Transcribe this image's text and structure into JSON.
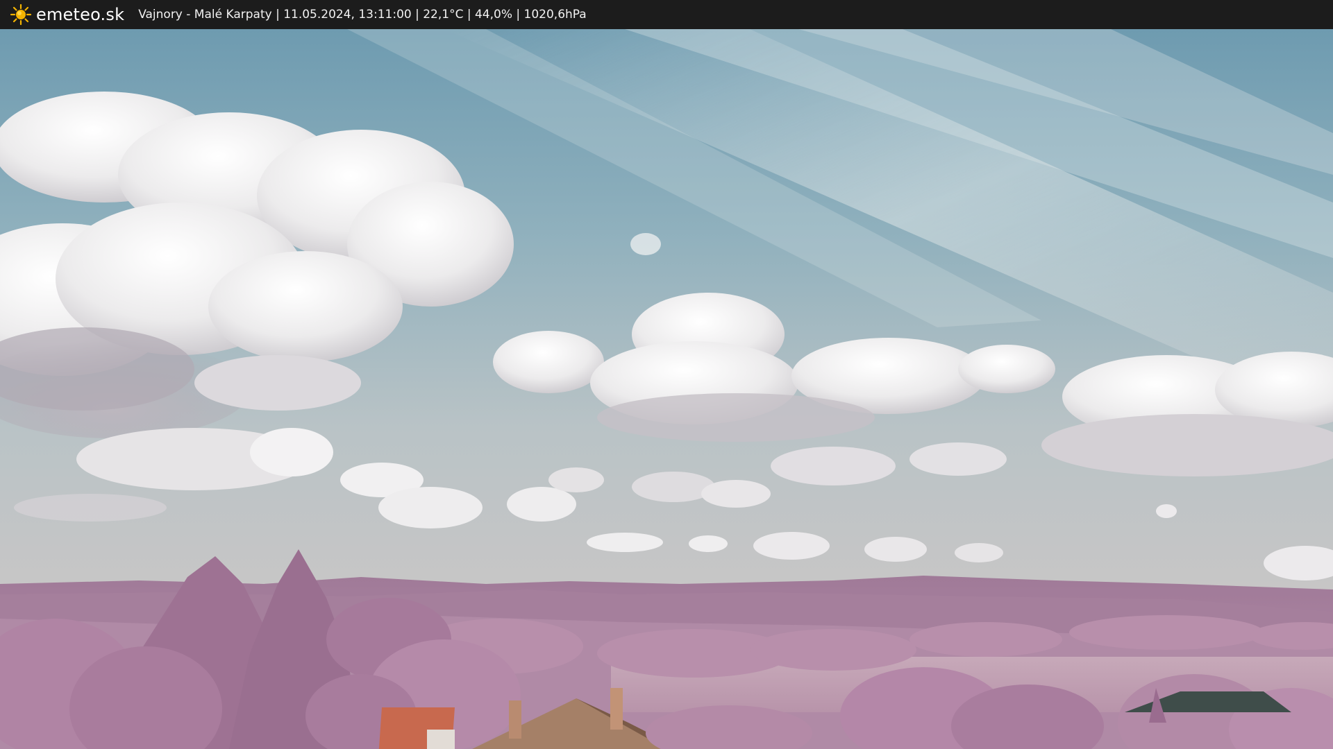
{
  "header": {
    "logo_icon": "sun-icon",
    "brand": "emeteo.sk",
    "caption": "Vajnory - Malé Karpaty | 11.05.2024, 13:11:00 | 22,1°C | 44,0% | 1020,6hPa"
  },
  "colors": {
    "bar": "#1c1c1c",
    "sun": "#f4b400",
    "sky_top": "#6f9db0",
    "hills": "#a77e9d",
    "foliage": "#b78aa8"
  }
}
